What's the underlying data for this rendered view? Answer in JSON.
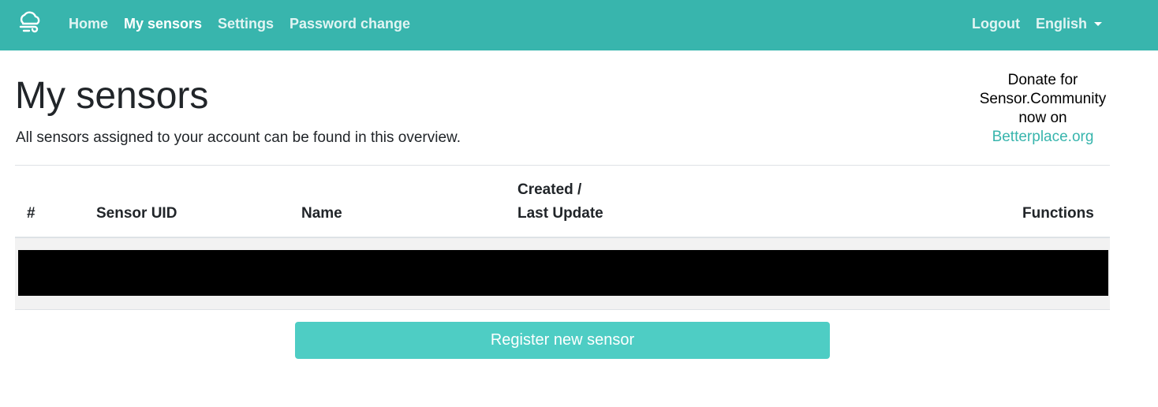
{
  "navbar": {
    "brand_icon": "cloud-wind-icon",
    "items": [
      {
        "label": "Home"
      },
      {
        "label": "My sensors",
        "active": true
      },
      {
        "label": "Settings"
      },
      {
        "label": "Password change"
      }
    ],
    "logout_label": "Logout",
    "language_label": "English",
    "background_color": "#38b5ad"
  },
  "page": {
    "title": "My sensors",
    "lead": "All sensors assigned to your account can be found in this overview."
  },
  "donate": {
    "line1": "Donate for",
    "line2": "Sensor.Community",
    "line3": "now on",
    "link_label": "Betterplace.org"
  },
  "table": {
    "headers": {
      "index": "#",
      "sensor_uid": "Sensor UID",
      "name": "Name",
      "created": "Created /",
      "last_update": "Last Update",
      "functions": "Functions"
    }
  },
  "actions": {
    "register_label": "Register new sensor",
    "button_color": "#4ecdc4"
  }
}
